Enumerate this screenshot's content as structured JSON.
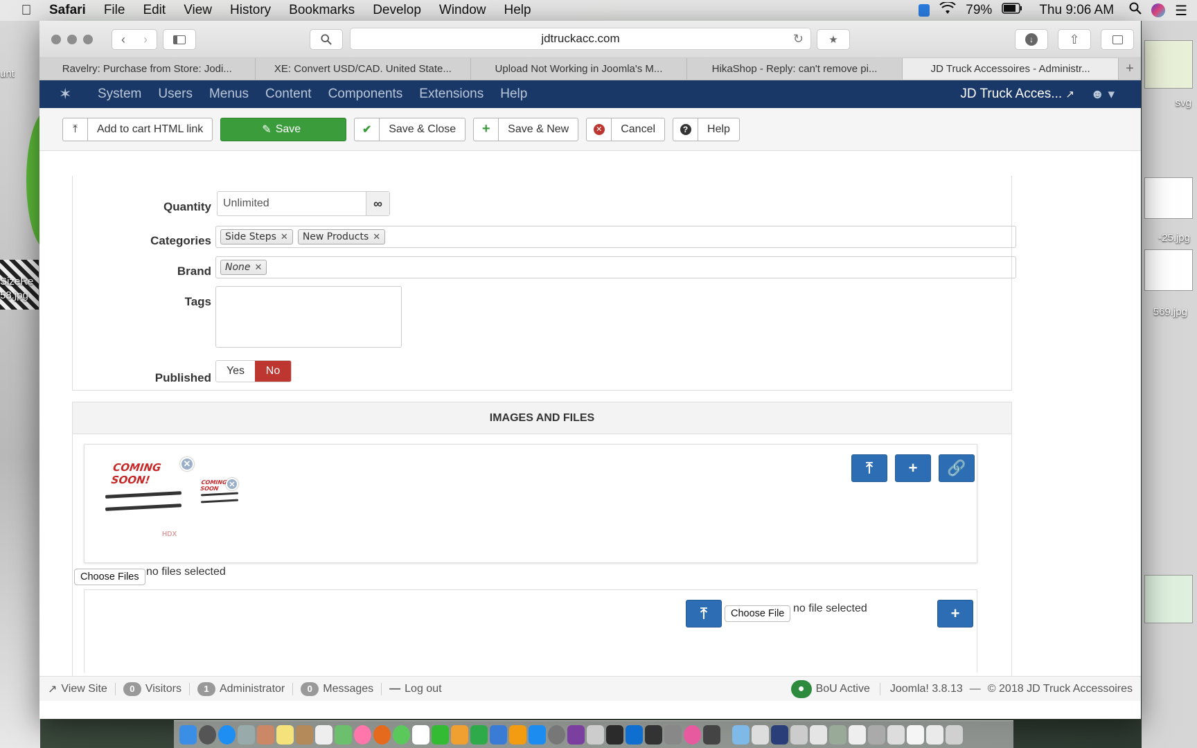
{
  "menubar": {
    "app": "Safari",
    "items": [
      "File",
      "Edit",
      "View",
      "History",
      "Bookmarks",
      "Develop",
      "Window",
      "Help"
    ],
    "battery": "79%",
    "clock": "Thu 9:06 AM"
  },
  "desktop": {
    "left_label_1": "unt",
    "left_label_2": "SizeRe",
    "left_label_3": "58.jpg",
    "right_label_1": "svg",
    "right_label_2": "-25.jpg",
    "right_label_3": "569.jpg"
  },
  "browser": {
    "url": "jdtruckacc.com",
    "tabs": [
      "Ravelry: Purchase from Store: Jodi...",
      "XE: Convert USD/CAD. United State...",
      "Upload Not Working in Joomla's M...",
      "HikaShop - Reply: can't remove pi...",
      "JD Truck Accessoires - Administr..."
    ]
  },
  "jnav": {
    "items": [
      "System",
      "Users",
      "Menus",
      "Content",
      "Components",
      "Extensions",
      "Help"
    ],
    "site": "JD Truck Acces..."
  },
  "actions": {
    "add_to_cart": "Add to cart HTML link",
    "save": "Save",
    "save_close": "Save & Close",
    "save_new": "Save & New",
    "cancel": "Cancel",
    "help": "Help"
  },
  "form": {
    "quantity_label": "Quantity",
    "quantity_value": "Unlimited",
    "categories_label": "Categories",
    "categories": [
      "Side Steps",
      "New Products"
    ],
    "brand_label": "Brand",
    "brand_value": "None",
    "tags_label": "Tags",
    "published_label": "Published",
    "published_yes": "Yes",
    "published_no": "No"
  },
  "images": {
    "section_title": "IMAGES AND FILES",
    "image_text": "COMING SOON!",
    "image_text_small": "COMING SOON",
    "watermark": "HDX",
    "choose_files": "Choose Files",
    "no_files": "no files selected",
    "choose_file": "Choose File",
    "no_file": "no file selected"
  },
  "statusbar": {
    "view_site": "View Site",
    "visitors_count": "0",
    "visitors": "Visitors",
    "admin_count": "1",
    "admin": "Administrator",
    "messages_count": "0",
    "messages": "Messages",
    "logout": "Log out",
    "bou": "BoU Active",
    "version": "Joomla! 3.8.13",
    "copyright": "© 2018 JD Truck Accessoires"
  },
  "colors": {
    "joomla_nav": "#1a3867",
    "save_green": "#3b9c3b",
    "no_red": "#bd362f",
    "primary_blue": "#2d6db3"
  }
}
